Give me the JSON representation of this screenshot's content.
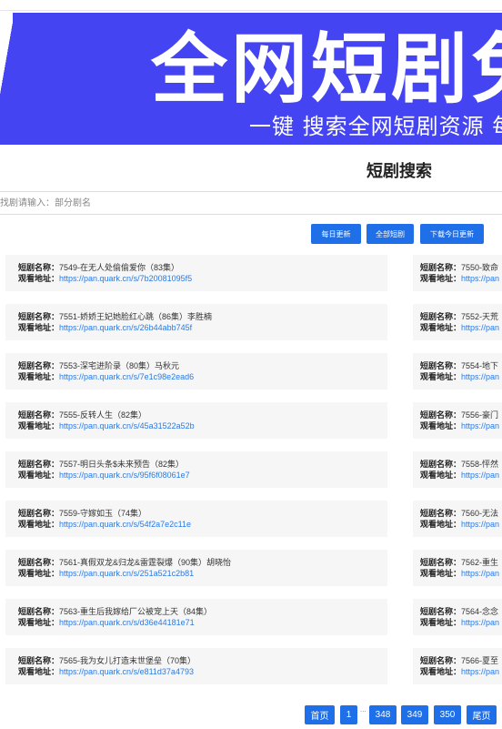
{
  "banner": {
    "title": "全网短剧免",
    "subtitle": "一键 搜索全网短剧资源 每"
  },
  "page_title": "短剧搜索",
  "search": {
    "placeholder": "找剧请输入：部分剧名"
  },
  "buttons": {
    "daily_update": "每日更新",
    "all_dramas": "全部短剧",
    "download_today": "下载今日更新"
  },
  "labels": {
    "name": "短剧名称：",
    "url": "观看地址："
  },
  "left_cards": [
    {
      "name": "7549-在无人处偷偷爱你（83集）",
      "url": "https://pan.quark.cn/s/7b20081095f5"
    },
    {
      "name": "7551-娇娇王妃她脸红心跳（86集）李胜楠",
      "url": "https://pan.quark.cn/s/26b44abb745f"
    },
    {
      "name": "7553-深宅进阶录（80集）马秋元",
      "url": "https://pan.quark.cn/s/7e1c98e2ead6"
    },
    {
      "name": "7555-反转人生（82集）",
      "url": "https://pan.quark.cn/s/45a31522a52b"
    },
    {
      "name": "7557-明日头条$未来预告（82集）",
      "url": "https://pan.quark.cn/s/95f6f08061e7"
    },
    {
      "name": "7559-守嫁如玉（74集）",
      "url": "https://pan.quark.cn/s/54f2a7e2c11e"
    },
    {
      "name": "7561-真假双龙&归龙&雷霆裂爆（90集）胡晓怡",
      "url": "https://pan.quark.cn/s/251a521c2b81"
    },
    {
      "name": "7563-重生后我嫁给厂公被宠上天（84集）",
      "url": "https://pan.quark.cn/s/d36e44181e71"
    },
    {
      "name": "7565-我为女儿打造末世堡垒（70集）",
      "url": "https://pan.quark.cn/s/e811d37a4793"
    }
  ],
  "right_cards": [
    {
      "name": "7550-致命",
      "url": "https://pan"
    },
    {
      "name": "7552-天荒",
      "url": "https://pan"
    },
    {
      "name": "7554-地下",
      "url": "https://pan"
    },
    {
      "name": "7556-豪门",
      "url": "https://pan"
    },
    {
      "name": "7558-怦然",
      "url": "https://pan"
    },
    {
      "name": "7560-无法",
      "url": "https://pan"
    },
    {
      "name": "7562-重生",
      "url": "https://pan"
    },
    {
      "name": "7564-念念",
      "url": "https://pan"
    },
    {
      "name": "7566-夏至",
      "url": "https://pan"
    }
  ],
  "pager": {
    "first": "首页",
    "p1": "1",
    "dots": "...",
    "p348": "348",
    "p349": "349",
    "p350": "350",
    "last": "尾页"
  },
  "colors": {
    "banner": "#4444f2",
    "button": "#1e6fe8",
    "link": "#2a7ae2"
  }
}
